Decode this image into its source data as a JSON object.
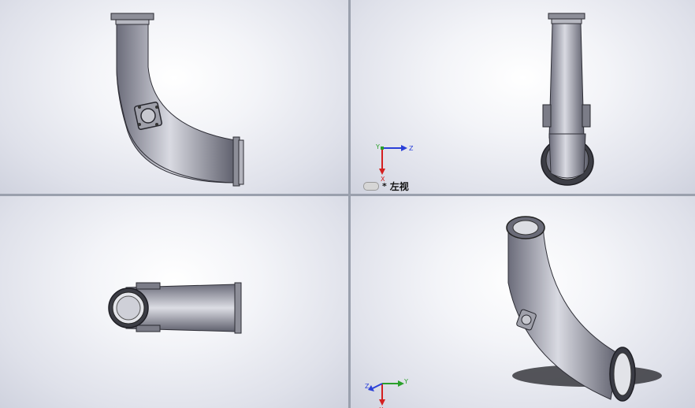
{
  "viewports": {
    "top_left": {
      "name": ""
    },
    "top_right": {
      "name": "左视",
      "modified_marker": "*"
    },
    "bottom_left": {
      "name": ""
    },
    "bottom_right": {
      "name": ""
    }
  },
  "triad_right": {
    "y_label": "Y",
    "z_label": "Z",
    "x_label": "X"
  },
  "triad_iso": {
    "z_label": "Z",
    "y_label": "Y",
    "x_label": "X"
  },
  "colors": {
    "x_axis": "#d42020",
    "y_axis": "#2aa02a",
    "z_axis": "#2a3fd8",
    "pipe_dark": "#5f6070",
    "pipe_light": "#d8d9e0"
  },
  "icons": [
    "coordinate-triad-icon",
    "view-orientation-badge-icon"
  ]
}
